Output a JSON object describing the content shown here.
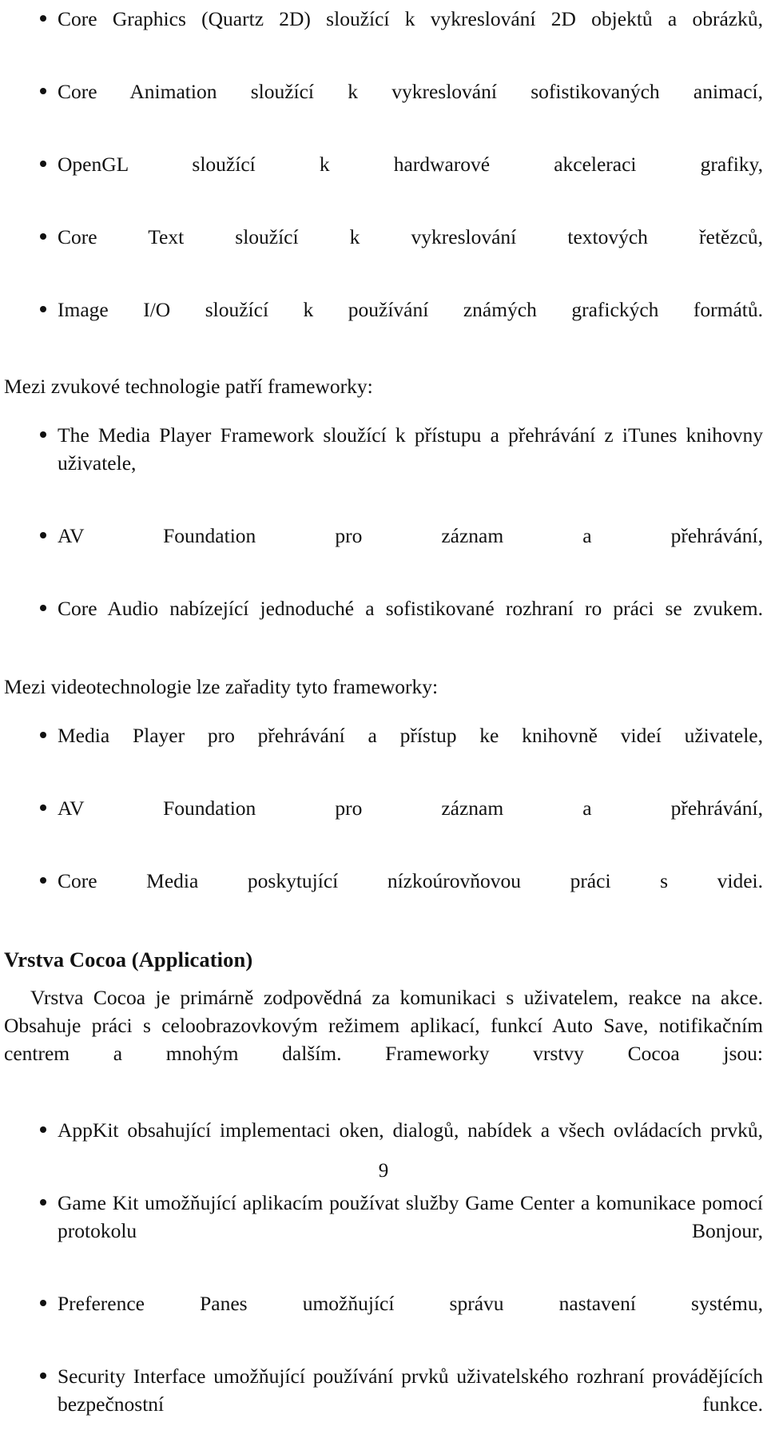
{
  "page": {
    "number": "9",
    "language": "cs"
  },
  "graphics_list": {
    "items": [
      "Core Graphics (Quartz 2D) sloužící k vykreslování 2D objektů a obrázků,",
      "Core Animation sloužící k vykreslování sofistikovaných animací,",
      "OpenGL sloužící k hardwarové akceleraci grafiky,",
      "Core Text sloužící k vykreslování textových řetězců,",
      "Image I/O sloužící k používání známých grafických formátů."
    ]
  },
  "audio_section": {
    "lead": "Mezi zvukové technologie patří frameworky:",
    "items": [
      "The Media Player Framework sloužící k přístupu a přehrávání z iTunes knihovny uživatele,",
      "AV Foundation pro záznam a přehrávání,",
      "Core Audio nabízející jednoduché a sofistikované rozhraní ro práci se zvukem."
    ]
  },
  "video_section": {
    "lead": "Mezi videotechnologie lze zařadity tyto frameworky:",
    "items": [
      "Media Player pro přehrávání a přístup ke knihovně videí uživatele,",
      "AV Foundation pro záznam a přehrávání,",
      "Core Media poskytující nízkoúrovňovou práci s videi."
    ]
  },
  "cocoa_section": {
    "heading": "Vrstva Cocoa (Application)",
    "paragraph": "Vrstva Cocoa je primárně zodpovědná za komunikaci s uživatelem, reakce na akce. Obsahuje práci s celoobrazovkovým režimem aplikací, funkcí Auto Save, notifikačním centrem a mnohým dalším. Frameworky vrstvy Cocoa jsou:",
    "items": [
      "AppKit obsahující implementaci oken, dialogů, nabídek a všech ovládacích prvků,",
      "Game Kit umožňující aplikacím používat služby Game Center a komunikace pomocí protokolu Bonjour,",
      "Preference Panes umožňující správu nastavení systému,",
      "Security Interface umožňující používání prvků uživatelského rozhraní provádějících bezpečnostní funkce."
    ]
  }
}
